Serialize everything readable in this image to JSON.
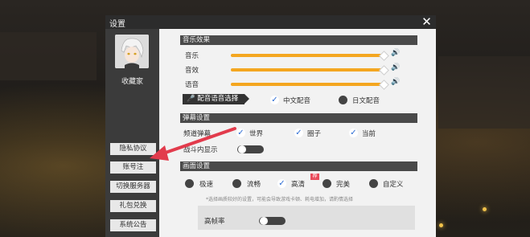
{
  "dialog": {
    "title": "设置",
    "close_icon": "close-icon"
  },
  "profile": {
    "name": "收藏家"
  },
  "sidebar": {
    "items": [
      {
        "label": "隐私协议"
      },
      {
        "label": "账号注"
      },
      {
        "label": "切换服务器"
      },
      {
        "label": "礼包兑换"
      },
      {
        "label": "系统公告"
      }
    ]
  },
  "audio": {
    "heading": "音乐效果",
    "rows": [
      {
        "label": "音乐",
        "value_percent": 100
      },
      {
        "label": "音效",
        "value_percent": 100
      },
      {
        "label": "语音",
        "value_percent": 100
      }
    ],
    "voice_select_label": "配音语音选择",
    "voice_options": [
      {
        "label": "中文配音",
        "selected": true
      },
      {
        "label": "日文配音",
        "selected": false
      }
    ]
  },
  "danmaku": {
    "heading": "弹幕设置",
    "channel_label": "频道弹幕",
    "channels": [
      {
        "label": "世界",
        "checked": true
      },
      {
        "label": "圈子",
        "checked": true
      },
      {
        "label": "当前",
        "checked": true
      }
    ],
    "battle_label": "战斗内显示",
    "battle_on": false
  },
  "graphics": {
    "heading": "画面设置",
    "options": [
      {
        "label": "极速",
        "selected": false
      },
      {
        "label": "流畅",
        "selected": false
      },
      {
        "label": "高清",
        "selected": true
      },
      {
        "label": "完美",
        "selected": false
      },
      {
        "label": "自定义",
        "selected": false
      }
    ],
    "badge": "荐",
    "note": "*选择画质较好的设置，可能会导致游戏卡顿、耗电增加，请酌情选择",
    "fps_label": "高帧率",
    "fps_on": false
  },
  "colors": {
    "accent": "#f4a620",
    "header": "#4a4a4a",
    "check": "#2c6cd4",
    "arrow": "#e23b4c"
  }
}
